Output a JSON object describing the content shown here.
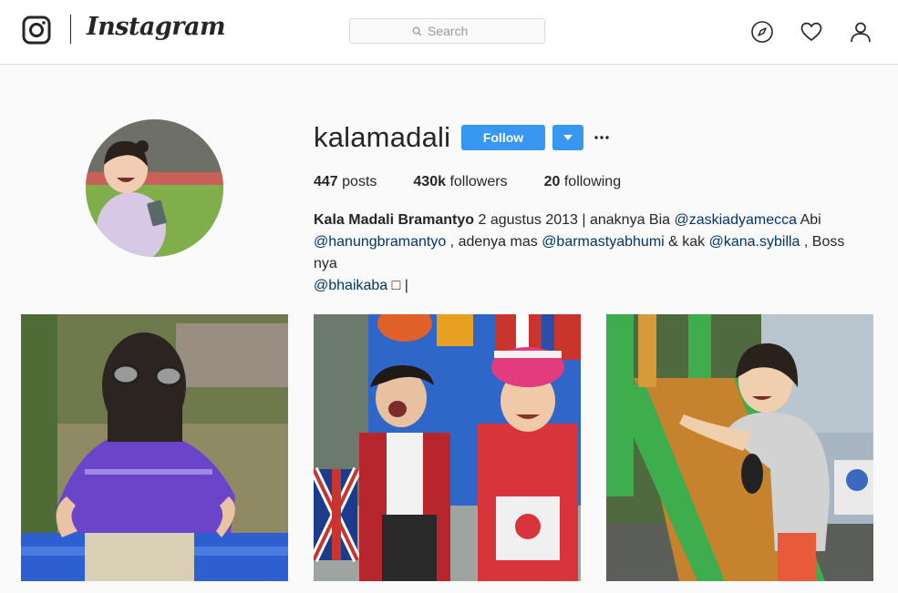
{
  "nav": {
    "brand": "Instagram",
    "search_placeholder": "Search",
    "icons": [
      "compass-icon",
      "heart-icon",
      "user-icon"
    ]
  },
  "profile": {
    "username": "kalamadali",
    "follow_label": "Follow",
    "stats": {
      "posts_count": "447",
      "posts_label": "posts",
      "followers_count": "430k",
      "followers_label": "followers",
      "following_count": "20",
      "following_label": "following"
    },
    "bio": {
      "name": "Kala Madali Bramantyo",
      "t1": " 2 agustus 2013 | anaknya Bia ",
      "m1": "@zaskiadyamecca",
      "t2": " Abi",
      "m2": "@hanungbramantyo",
      "t3": " , adenya mas ",
      "m3": "@barmastyabhumi",
      "t4": " & kak ",
      "m4": "@kana.sybilla",
      "t5": " , Boss nya",
      "m5": "@bhaikaba",
      "t6": " □ |"
    }
  },
  "colors": {
    "accent": "#3897f0",
    "mention": "#003569",
    "text": "#262626",
    "background": "#fafafa",
    "border": "#dbdbdb"
  }
}
